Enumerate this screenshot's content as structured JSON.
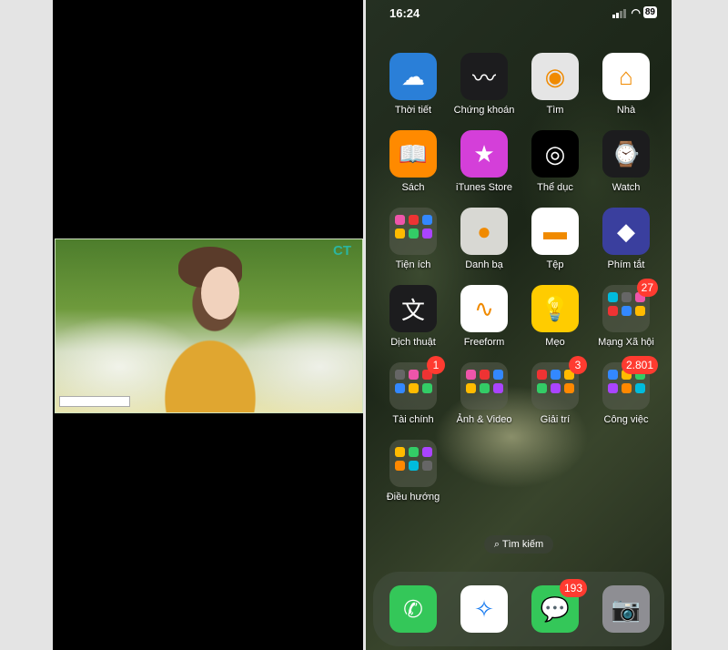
{
  "left_screen": {
    "video": {
      "logo": "CT"
    }
  },
  "status_bar": {
    "time": "16:24",
    "battery": "89"
  },
  "apps": [
    {
      "label": "Thời tiết",
      "icon": "weather-icon",
      "color": "#2a7fd8"
    },
    {
      "label": "Chứng khoán",
      "icon": "stocks-icon",
      "color": "#1c1c1e"
    },
    {
      "label": "Tìm",
      "icon": "find-my-icon",
      "color": "#e5e5e5"
    },
    {
      "label": "Nhà",
      "icon": "home-icon",
      "color": "#ffffff"
    },
    {
      "label": "Sách",
      "icon": "books-icon",
      "color": "#ff8a00"
    },
    {
      "label": "iTunes Store",
      "icon": "star-icon",
      "color": "#d43fd9"
    },
    {
      "label": "Thể dục",
      "icon": "activity-rings-icon",
      "color": "#000000"
    },
    {
      "label": "Watch",
      "icon": "watch-icon",
      "color": "#1c1c1e"
    },
    {
      "label": "Tiện ích",
      "icon": "utilities-folder-icon",
      "color": "folder"
    },
    {
      "label": "Danh bạ",
      "icon": "contacts-icon",
      "color": "#d8d8d3"
    },
    {
      "label": "Tệp",
      "icon": "folder-icon",
      "color": "#ffffff"
    },
    {
      "label": "Phím tắt",
      "icon": "shortcuts-icon",
      "color": "#3a3f9e"
    },
    {
      "label": "Dịch thuật",
      "icon": "translate-icon",
      "color": "#1c1c1e"
    },
    {
      "label": "Freeform",
      "icon": "freeform-icon",
      "color": "#ffffff"
    },
    {
      "label": "Mẹo",
      "icon": "lightbulb-icon",
      "color": "#ffcc00"
    },
    {
      "label": "Mạng Xã hội",
      "icon": "social-folder-icon",
      "color": "folder",
      "badge": "27"
    },
    {
      "label": "Tài chính",
      "icon": "finance-folder-icon",
      "color": "folder",
      "badge": "1"
    },
    {
      "label": "Ảnh & Video",
      "icon": "photo-video-folder-icon",
      "color": "folder"
    },
    {
      "label": "Giải trí",
      "icon": "entertainment-folder-icon",
      "color": "folder",
      "badge": "3"
    },
    {
      "label": "Công việc",
      "icon": "work-folder-icon",
      "color": "folder",
      "badge": "2.801"
    },
    {
      "label": "Điều hướng",
      "icon": "navigation-folder-icon",
      "color": "folder"
    }
  ],
  "search": {
    "label": "Tìm kiếm"
  },
  "dock": [
    {
      "name": "phone",
      "icon": "phone-icon",
      "color": "#34c759"
    },
    {
      "name": "safari",
      "icon": "compass-icon",
      "color": "#ffffff"
    },
    {
      "name": "messages",
      "icon": "message-icon",
      "color": "#34c759",
      "badge": "193"
    },
    {
      "name": "camera",
      "icon": "camera-icon",
      "color": "#8e8e93"
    }
  ]
}
